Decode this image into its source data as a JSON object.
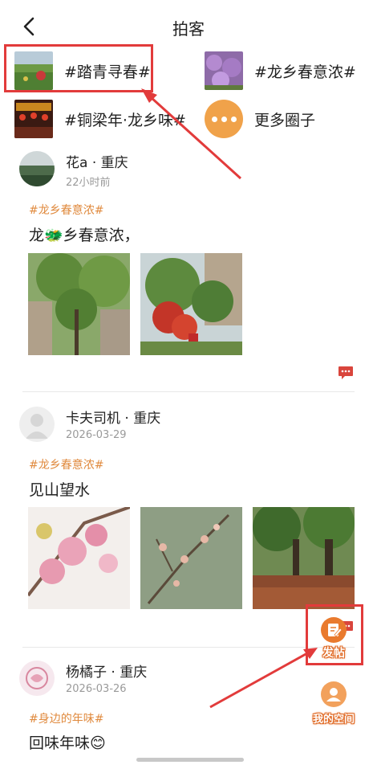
{
  "header": {
    "title": "拍客"
  },
  "circles": [
    {
      "label": "#踏青寻春#"
    },
    {
      "label": "#龙乡春意浓#"
    },
    {
      "label": "#铜梁年·龙乡味#"
    },
    {
      "label": "更多圈子"
    }
  ],
  "posts": [
    {
      "author": "花a · 重庆",
      "time": "22小时前",
      "tag": "#龙乡春意浓#",
      "text": "龙🐲乡春意浓，"
    },
    {
      "author": "卡夫司机 · 重庆",
      "time": "2026-03-29",
      "tag": "#龙乡春意浓#",
      "text": "见山望水"
    },
    {
      "author": "杨橘子 · 重庆",
      "time": "2026-03-26",
      "tag": "#身边的年味#",
      "text": "回味年味😊"
    }
  ],
  "floating": {
    "post_label": "发帖",
    "space_label": "我的空间"
  },
  "colors": {
    "accent": "#e08a3e",
    "annotation": "#e23b3b",
    "comment": "#d9453c"
  }
}
